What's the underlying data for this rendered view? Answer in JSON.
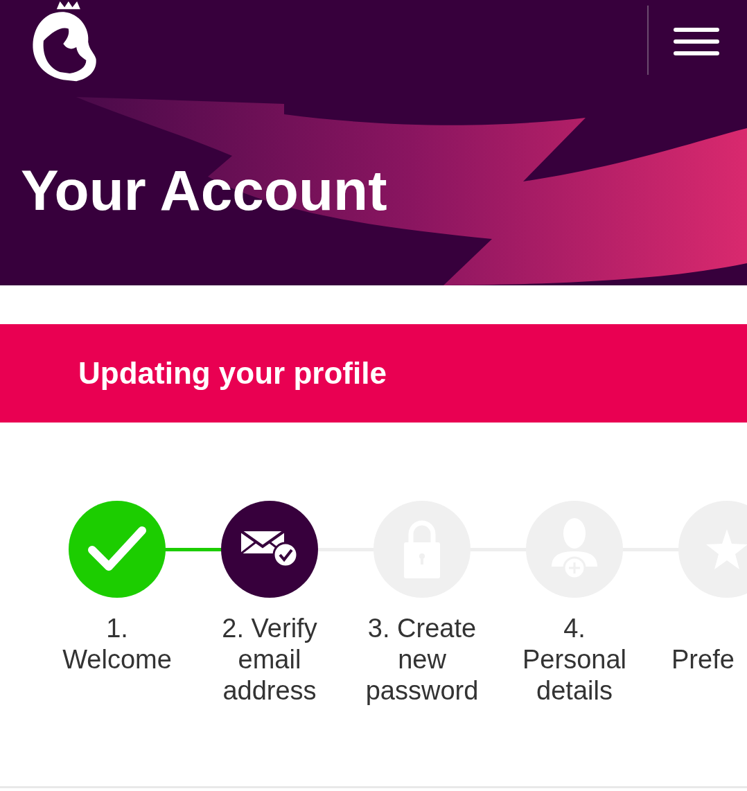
{
  "header": {
    "title": "Your Account"
  },
  "banner": {
    "title": "Updating your profile"
  },
  "steps": [
    {
      "kind": "check",
      "completed": true,
      "selected": false,
      "label_lines": [
        "1.",
        "Welcome"
      ]
    },
    {
      "kind": "email",
      "completed": false,
      "selected": true,
      "label_lines": [
        "2. Verify",
        "email",
        "address"
      ]
    },
    {
      "kind": "lock",
      "completed": false,
      "selected": false,
      "label_lines": [
        "3. Create",
        "new",
        "password"
      ]
    },
    {
      "kind": "person",
      "completed": false,
      "selected": false,
      "label_lines": [
        "4.",
        "Personal",
        "details"
      ]
    },
    {
      "kind": "star",
      "completed": false,
      "selected": false,
      "label_lines": [
        "Prefe"
      ]
    }
  ]
}
